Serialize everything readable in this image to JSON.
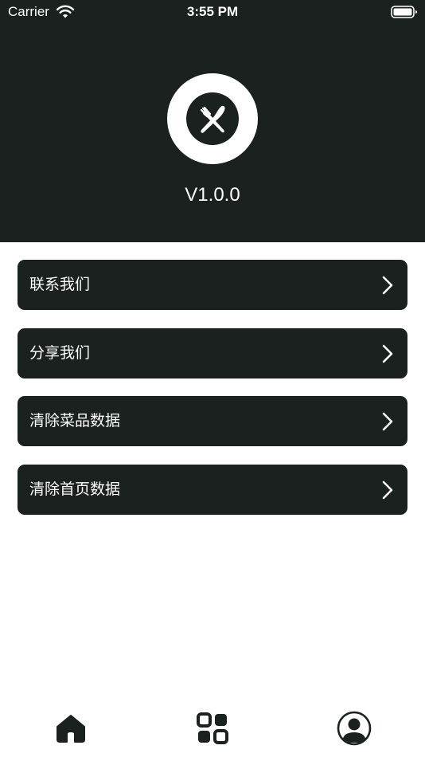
{
  "status_bar": {
    "carrier": "Carrier",
    "time": "3:55 PM"
  },
  "header": {
    "logo_icon": "fork-knife-icon",
    "version": "V1.0.0",
    "background_color": "#1a211e"
  },
  "menu": {
    "items": [
      {
        "label": "联系我们"
      },
      {
        "label": "分享我们"
      },
      {
        "label": "清除菜品数据"
      },
      {
        "label": "清除首页数据"
      }
    ]
  },
  "tab_bar": {
    "tabs": [
      {
        "icon": "home-icon",
        "selected": true
      },
      {
        "icon": "grid-icon",
        "selected": false
      },
      {
        "icon": "profile-icon",
        "selected": false
      }
    ]
  }
}
